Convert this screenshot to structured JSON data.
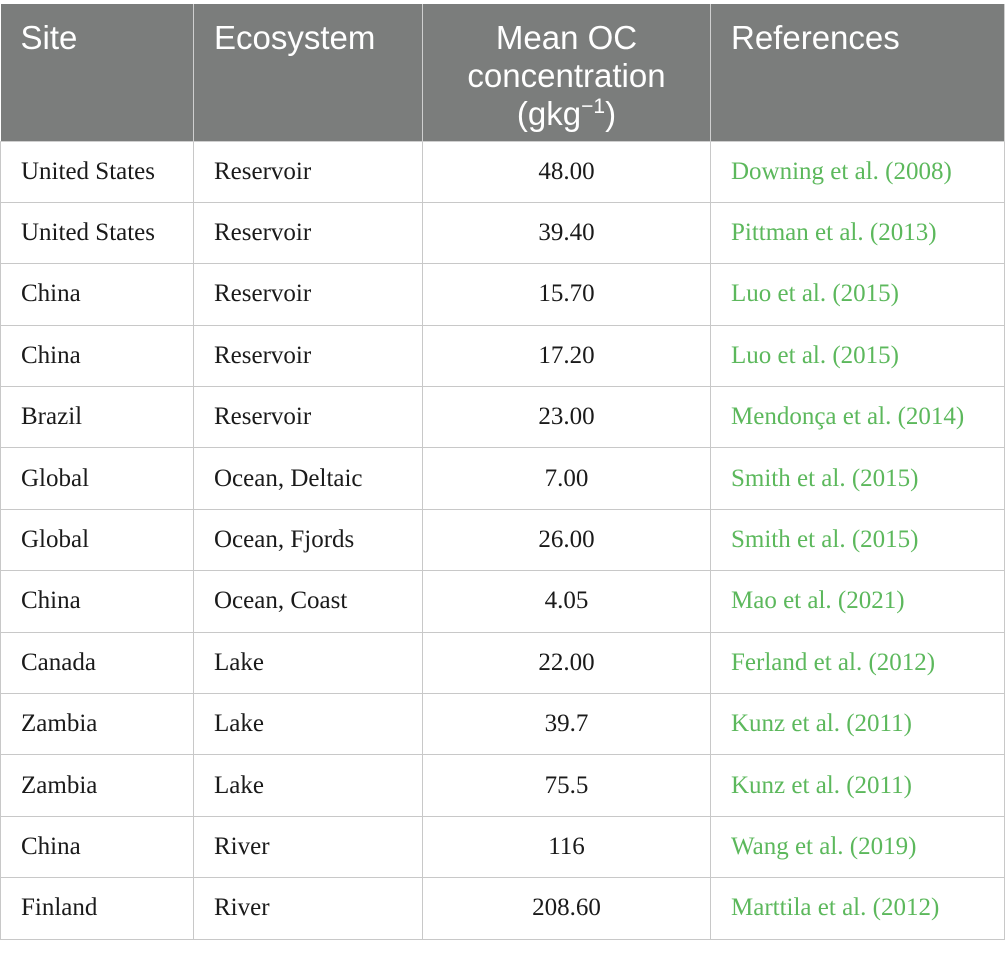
{
  "header": {
    "site": "Site",
    "ecosystem": "Ecosystem",
    "mean_oc_line1": "Mean OC",
    "mean_oc_line2": "concentration",
    "mean_oc_unit_base": "(gkg",
    "mean_oc_unit_exp": "−1",
    "mean_oc_unit_close": ")",
    "references": "References"
  },
  "rows": [
    {
      "site": "United States",
      "ecosystem": "Reservoir",
      "mean_oc": "48.00",
      "reference": "Downing et al. (2008)"
    },
    {
      "site": "United States",
      "ecosystem": "Reservoir",
      "mean_oc": "39.40",
      "reference": "Pittman et al. (2013)"
    },
    {
      "site": "China",
      "ecosystem": "Reservoir",
      "mean_oc": "15.70",
      "reference": "Luo et al. (2015)"
    },
    {
      "site": "China",
      "ecosystem": "Reservoir",
      "mean_oc": "17.20",
      "reference": "Luo et al. (2015)"
    },
    {
      "site": "Brazil",
      "ecosystem": "Reservoir",
      "mean_oc": "23.00",
      "reference": "Mendonça et al. (2014)"
    },
    {
      "site": "Global",
      "ecosystem": "Ocean, Deltaic",
      "mean_oc": "7.00",
      "reference": "Smith et al. (2015)"
    },
    {
      "site": "Global",
      "ecosystem": "Ocean, Fjords",
      "mean_oc": "26.00",
      "reference": "Smith et al. (2015)"
    },
    {
      "site": "China",
      "ecosystem": "Ocean, Coast",
      "mean_oc": "4.05",
      "reference": "Mao et al. (2021)"
    },
    {
      "site": "Canada",
      "ecosystem": "Lake",
      "mean_oc": "22.00",
      "reference": "Ferland et al. (2012)"
    },
    {
      "site": "Zambia",
      "ecosystem": "Lake",
      "mean_oc": "39.7",
      "reference": "Kunz et al. (2011)"
    },
    {
      "site": "Zambia",
      "ecosystem": "Lake",
      "mean_oc": "75.5",
      "reference": "Kunz et al. (2011)"
    },
    {
      "site": "China",
      "ecosystem": "River",
      "mean_oc": "116",
      "reference": "Wang et al. (2019)"
    },
    {
      "site": "Finland",
      "ecosystem": "River",
      "mean_oc": "208.60",
      "reference": "Marttila et al. (2012)"
    }
  ],
  "colors": {
    "header_bg": "#7b7d7c",
    "header_text": "#ffffff",
    "reference_link": "#5cb85c"
  }
}
